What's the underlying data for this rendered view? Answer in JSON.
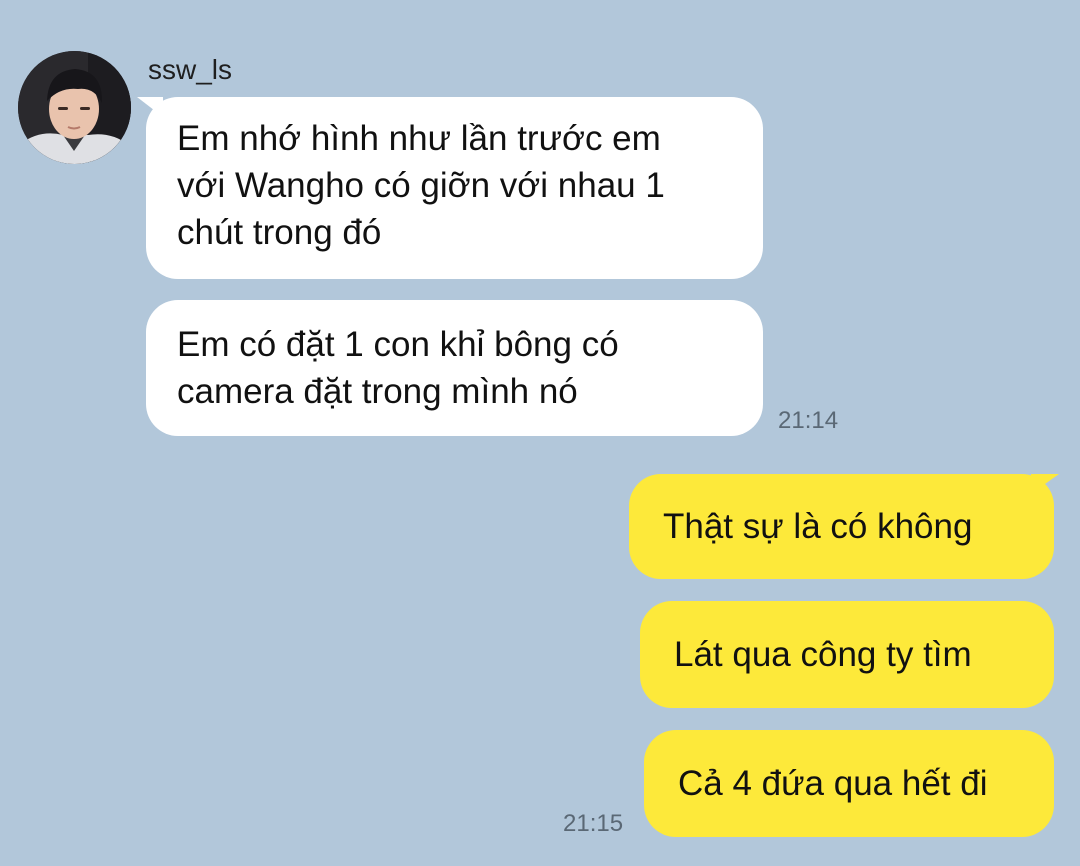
{
  "contact": {
    "name": "ssw_ls",
    "avatar_icon": "profile-photo-avatar"
  },
  "messages_in": [
    {
      "text_lines": [
        "Em nhớ hình như lần trước em",
        "với Wangho có giỡn với nhau 1",
        "chút trong đó"
      ]
    },
    {
      "text_lines": [
        "Em có đặt 1 con khỉ bông có",
        "camera đặt trong mình nó"
      ]
    }
  ],
  "time_in": "21:14",
  "messages_out": [
    {
      "text": "Thật sự là có không"
    },
    {
      "text": "Lát qua công ty tìm"
    },
    {
      "text": "Cả 4 đứa qua hết đi"
    }
  ],
  "time_out": "21:15",
  "colors": {
    "background": "#b2c7da",
    "incoming_bubble": "#ffffff",
    "outgoing_bubble": "#fde93a"
  }
}
